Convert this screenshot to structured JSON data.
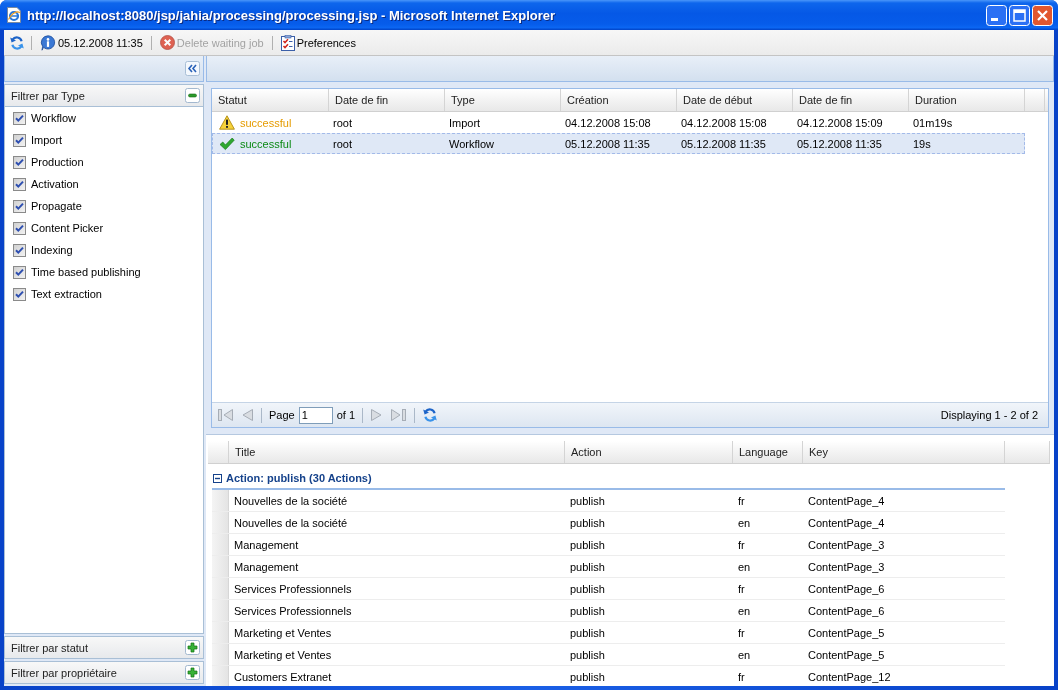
{
  "window": {
    "title": "http://localhost:8080/jsp/jahia/processing/processing.jsp - Microsoft Internet Explorer"
  },
  "toolbar": {
    "items": [
      {
        "kind": "refresh"
      },
      {
        "kind": "info",
        "label": "05.12.2008 11:35"
      },
      {
        "kind": "delete",
        "label": "Delete waiting job",
        "disabled": true
      },
      {
        "kind": "preferences",
        "label": "Preferences",
        "disabled": false
      }
    ]
  },
  "filters": [
    {
      "title": "Filtrer par Type",
      "expanded": true,
      "options": [
        {
          "label": "Workflow",
          "checked": true
        },
        {
          "label": "Import",
          "checked": true
        },
        {
          "label": "Production",
          "checked": true
        },
        {
          "label": "Activation",
          "checked": true
        },
        {
          "label": "Propagate",
          "checked": true
        },
        {
          "label": "Content Picker",
          "checked": true
        },
        {
          "label": "Indexing",
          "checked": true
        },
        {
          "label": "Time based publishing",
          "checked": true
        },
        {
          "label": "Text extraction",
          "checked": true
        }
      ]
    },
    {
      "title": "Filtrer par statut",
      "expanded": false
    },
    {
      "title": "Filtrer par propriétaire",
      "expanded": false
    }
  ],
  "jobs": {
    "columns": [
      "Statut",
      "Date de fin",
      "Type",
      "Création",
      "Date de début",
      "Date de fin",
      "Duration"
    ],
    "rows": [
      {
        "kind": "warning",
        "selected": false,
        "cells": [
          "successful",
          "root",
          "Import",
          "04.12.2008 15:08",
          "04.12.2008 15:08",
          "04.12.2008 15:09",
          "01m19s"
        ]
      },
      {
        "kind": "success",
        "selected": true,
        "cells": [
          "successful",
          "root",
          "Workflow",
          "05.12.2008 11:35",
          "05.12.2008 11:35",
          "05.12.2008 11:35",
          "19s"
        ]
      }
    ],
    "paging": {
      "before": "Page",
      "page": "1",
      "after": "of 1",
      "summary": "Displaying 1 - 2 of 2"
    }
  },
  "actions": {
    "columns": [
      "Title",
      "Action",
      "Language",
      "Key"
    ],
    "group": {
      "label": "Action: publish (30 Actions)",
      "expanded": true
    },
    "rows": [
      [
        "Nouvelles de la société",
        "publish",
        "fr",
        "ContentPage_4"
      ],
      [
        "Nouvelles de la société",
        "publish",
        "en",
        "ContentPage_4"
      ],
      [
        "Management",
        "publish",
        "fr",
        "ContentPage_3"
      ],
      [
        "Management",
        "publish",
        "en",
        "ContentPage_3"
      ],
      [
        "Services Professionnels",
        "publish",
        "fr",
        "ContentPage_6"
      ],
      [
        "Services Professionnels",
        "publish",
        "en",
        "ContentPage_6"
      ],
      [
        "Marketing et Ventes",
        "publish",
        "fr",
        "ContentPage_5"
      ],
      [
        "Marketing et Ventes",
        "publish",
        "en",
        "ContentPage_5"
      ],
      [
        "Customers Extranet",
        "publish",
        "fr",
        "ContentPage_12"
      ]
    ]
  }
}
